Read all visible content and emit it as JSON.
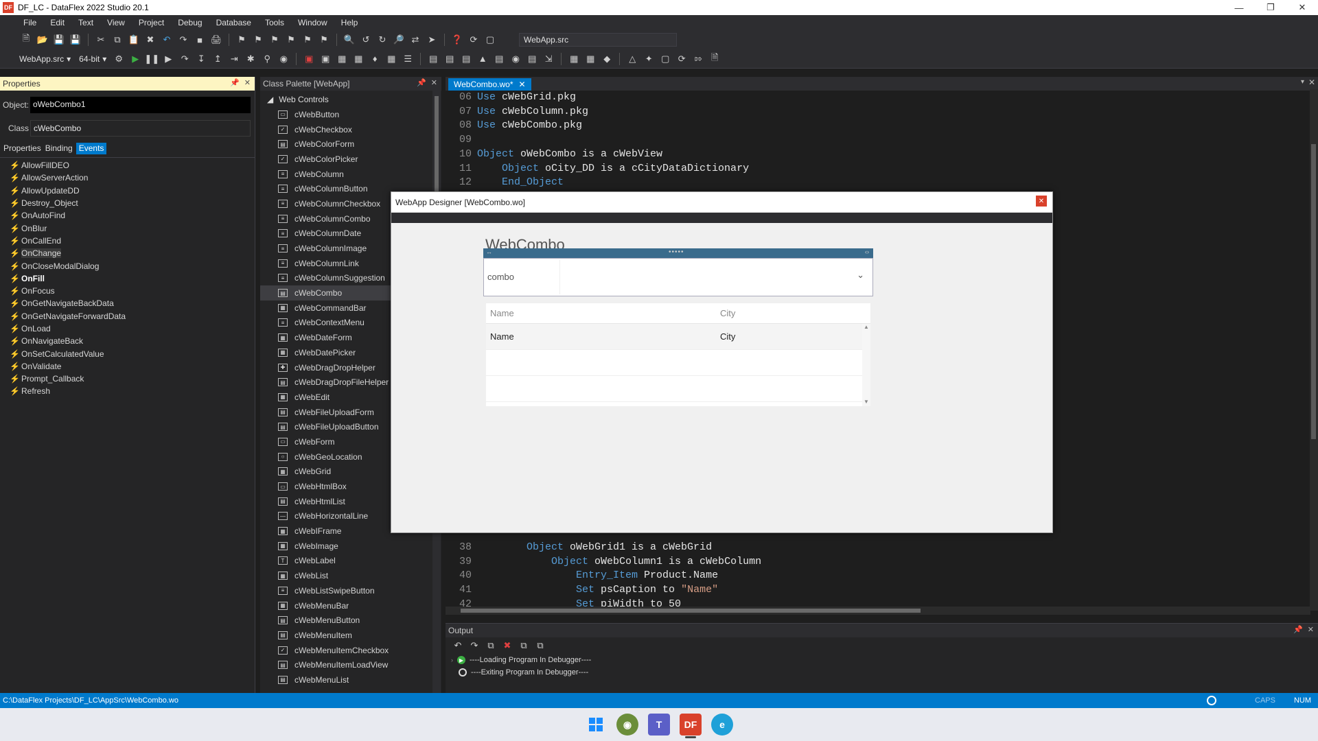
{
  "window": {
    "title": "DF_LC - DataFlex 2022 Studio 20.1",
    "logo": "DF"
  },
  "menu": [
    "File",
    "Edit",
    "Text",
    "View",
    "Project",
    "Debug",
    "Database",
    "Tools",
    "Window",
    "Help"
  ],
  "toolbar": {
    "source_file": "WebApp.src",
    "workspace_dropdown": "WebApp.src",
    "bitness_dropdown": "64-bit"
  },
  "properties_panel": {
    "title": "Properties",
    "object_label": "Object:",
    "object_value": "oWebCombo1",
    "class_label": "Class",
    "class_value": "cWebCombo",
    "tabs": [
      "Properties",
      "Binding",
      "Events"
    ],
    "active_tab": "Events",
    "events": [
      "AllowFillDEO",
      "AllowServerAction",
      "AllowUpdateDD",
      "Destroy_Object",
      "OnAutoFind",
      "OnBlur",
      "OnCallEnd",
      "OnChange",
      "OnCloseModalDialog",
      "OnFill",
      "OnFocus",
      "OnGetNavigateBackData",
      "OnGetNavigateForwardData",
      "OnLoad",
      "OnNavigateBack",
      "OnSetCalculatedValue",
      "OnValidate",
      "Prompt_Callback",
      "Refresh"
    ]
  },
  "class_palette": {
    "title": "Class Palette [WebApp]",
    "group": "Web Controls",
    "items": [
      "cWebButton",
      "cWebCheckbox",
      "cWebColorForm",
      "cWebColorPicker",
      "cWebColumn",
      "cWebColumnButton",
      "cWebColumnCheckbox",
      "cWebColumnCombo",
      "cWebColumnDate",
      "cWebColumnImage",
      "cWebColumnLink",
      "cWebColumnSuggestion",
      "cWebCombo",
      "cWebCommandBar",
      "cWebContextMenu",
      "cWebDateForm",
      "cWebDatePicker",
      "cWebDragDropHelper",
      "cWebDragDropFileHelper",
      "cWebEdit",
      "cWebFileUploadForm",
      "cWebFileUploadButton",
      "cWebForm",
      "cWebGeoLocation",
      "cWebGrid",
      "cWebHtmlBox",
      "cWebHtmlList",
      "cWebHorizontalLine",
      "cWebIFrame",
      "cWebImage",
      "cWebLabel",
      "cWebList",
      "cWebListSwipeButton",
      "cWebMenuBar",
      "cWebMenuButton",
      "cWebMenuItem",
      "cWebMenuItemCheckbox",
      "cWebMenuItemLoadView",
      "cWebMenuList"
    ],
    "selected": "cWebCombo"
  },
  "editor": {
    "tab_label": "WebCombo.wo*",
    "lines_top": [
      {
        "n": "06",
        "kw": "Use",
        "rest": " cWebGrid.pkg"
      },
      {
        "n": "07",
        "kw": "Use",
        "rest": " cWebColumn.pkg"
      },
      {
        "n": "08",
        "kw": "Use",
        "rest": " cWebCombo.pkg"
      },
      {
        "n": "09",
        "kw": "",
        "rest": ""
      },
      {
        "n": "10",
        "kw": "Object",
        "rest": " oWebCombo is a cWebView"
      },
      {
        "n": "11",
        "kw": "    Object",
        "rest": " oCity_DD is a cCityDataDictionary"
      },
      {
        "n": "12",
        "kw": "    End_Object",
        "rest": ""
      }
    ],
    "lines_bottom": [
      {
        "n": "38",
        "kw": "        Object",
        "rest": " oWebGrid1 is a cWebGrid"
      },
      {
        "n": "39",
        "kw": "            Object",
        "rest": " oWebColumn1 is a cWebColumn"
      },
      {
        "n": "40",
        "kw": "                Entry_Item",
        "rest": " Product.Name"
      },
      {
        "n": "41",
        "kw": "                Set",
        "rest": " psCaption to ",
        "str": "\"Name\""
      },
      {
        "n": "42",
        "kw": "                Set",
        "rest": " piWidth to 50"
      }
    ]
  },
  "designer": {
    "title": "WebApp Designer [WebCombo.wo]",
    "view_title": "WebCombo",
    "combo_label": "combo",
    "grid_headers": [
      "Name",
      "City"
    ],
    "grid_first_row": [
      "Name",
      "City"
    ]
  },
  "output": {
    "title": "Output",
    "lines": [
      "----Loading Program In Debugger----",
      "----Exiting Program In Debugger----"
    ]
  },
  "statusbar": {
    "path": "C:\\DataFlex Projects\\DF_LC\\AppSrc\\WebCombo.wo",
    "caps": "CAPS",
    "num": "NUM"
  },
  "taskbar": [
    "windows-start",
    "globe-app",
    "teams",
    "dataflex",
    "edge"
  ],
  "colors": {
    "accent": "#007acc",
    "status_bar": "#007acc",
    "selection": "#3e3e42",
    "editor_bg": "#1e1e1e"
  }
}
